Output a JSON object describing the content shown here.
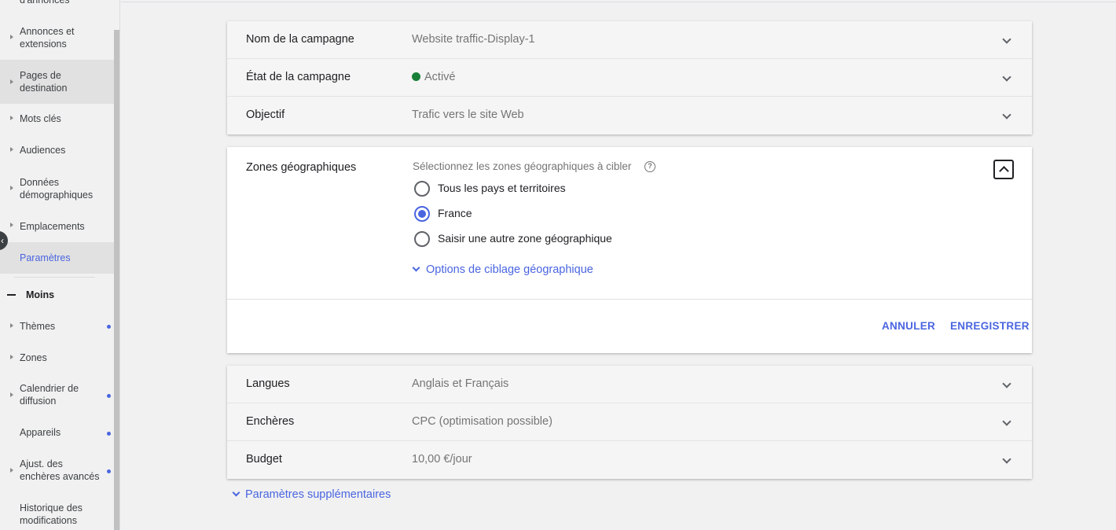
{
  "sidebar": {
    "top_partial": "d'annonces",
    "items": [
      {
        "label": "Annonces et\nextensions",
        "dot": false
      },
      {
        "label": "Pages de\ndestination",
        "dot": false
      },
      {
        "label": "Mots clés",
        "dot": false
      },
      {
        "label": "Audiences",
        "dot": false
      },
      {
        "label": "Données\ndémographiques",
        "dot": false
      },
      {
        "label": "Emplacements",
        "dot": false
      },
      {
        "label": "Paramètres",
        "dot": false,
        "active": true
      }
    ],
    "less_label": "Moins",
    "more_items": [
      {
        "label": "Thèmes",
        "dot": true
      },
      {
        "label": "Zones",
        "dot": false
      },
      {
        "label": "Calendrier de\ndiffusion",
        "dot": true
      },
      {
        "label": "Appareils",
        "dot": true
      },
      {
        "label": "Ajust. des\nenchères avancés",
        "dot": true
      },
      {
        "label": "Historique des\nmodifications",
        "dot": false
      }
    ]
  },
  "settings_top": [
    {
      "label": "Nom de la campagne",
      "value": "Website traffic-Display-1"
    },
    {
      "label": "État de la campagne",
      "value": "Activé",
      "status_color": "#188038"
    },
    {
      "label": "Objectif",
      "value": "Trafic vers le site Web"
    }
  ],
  "geo": {
    "title": "Zones géographiques",
    "prompt": "Sélectionnez les zones géographiques à cibler",
    "help_icon": "?",
    "options": [
      {
        "label": "Tous les pays et territoires",
        "checked": false
      },
      {
        "label": "France",
        "checked": true
      },
      {
        "label": "Saisir une autre zone géographique",
        "checked": false
      }
    ],
    "targeting_options": "Options de ciblage géographique",
    "cancel": "ANNULER",
    "save": "ENREGISTRER"
  },
  "settings_bottom": [
    {
      "label": "Langues",
      "value": "Anglais et Français"
    },
    {
      "label": "Enchères",
      "value": "CPC (optimisation possible)"
    },
    {
      "label": "Budget",
      "value": "10,00 €/jour"
    }
  ],
  "more_settings": "Paramètres supplémentaires",
  "colors": {
    "accent": "#4a65e0",
    "status_active": "#188038"
  }
}
